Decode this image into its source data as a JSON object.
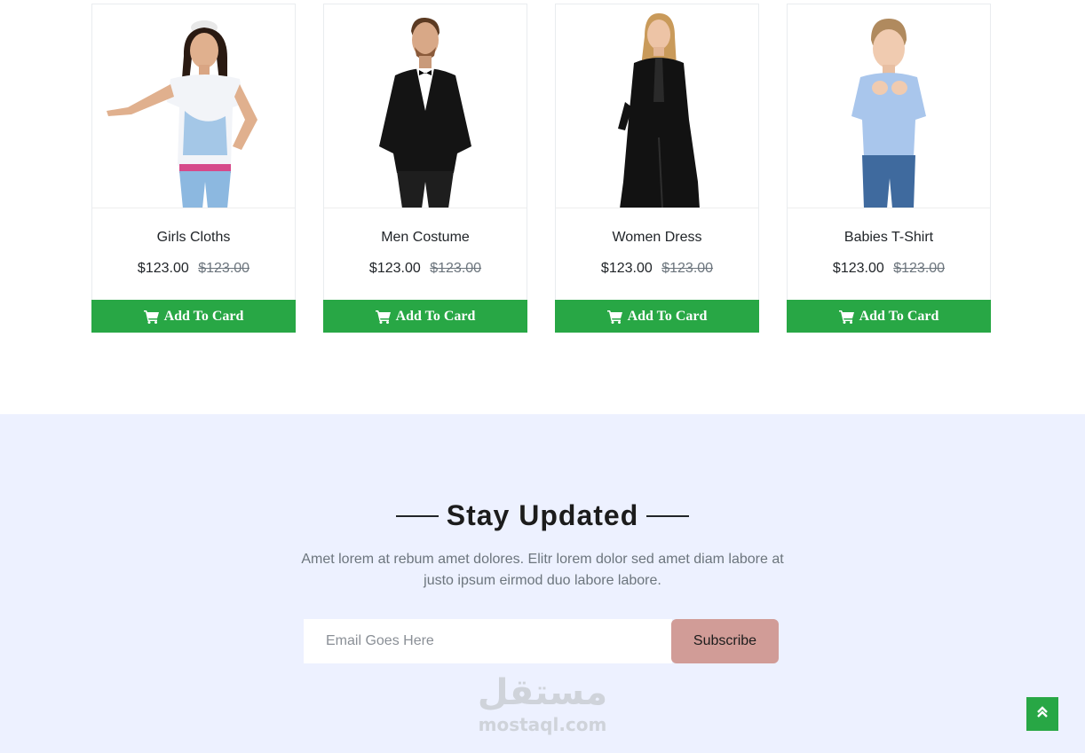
{
  "products": [
    {
      "name": "Girls Cloths",
      "price": "$123.00",
      "old_price": "$123.00",
      "button_label": "Add To Card"
    },
    {
      "name": "Men Costume",
      "price": "$123.00",
      "old_price": "$123.00",
      "button_label": "Add To Card"
    },
    {
      "name": "Women Dress",
      "price": "$123.00",
      "old_price": "$123.00",
      "button_label": "Add To Card"
    },
    {
      "name": "Babies T-Shirt",
      "price": "$123.00",
      "old_price": "$123.00",
      "button_label": "Add To Card"
    }
  ],
  "newsletter": {
    "title": "Stay Updated",
    "text": "Amet lorem at rebum amet dolores. Elitr lorem dolor sed amet diam labore at justo ipsum eirmod duo labore labore.",
    "email_placeholder": "Email Goes Here",
    "subscribe_label": "Subscribe"
  },
  "watermark": {
    "arabic": "مستقل",
    "latin": "mostaql.com"
  },
  "icons": {
    "cart": "cart-icon",
    "back_to_top": "double-chevron-up-icon"
  },
  "colors": {
    "accent_green": "#28a745",
    "subscribe_button": "#d19c97",
    "newsletter_bg": "#edf1ff"
  }
}
